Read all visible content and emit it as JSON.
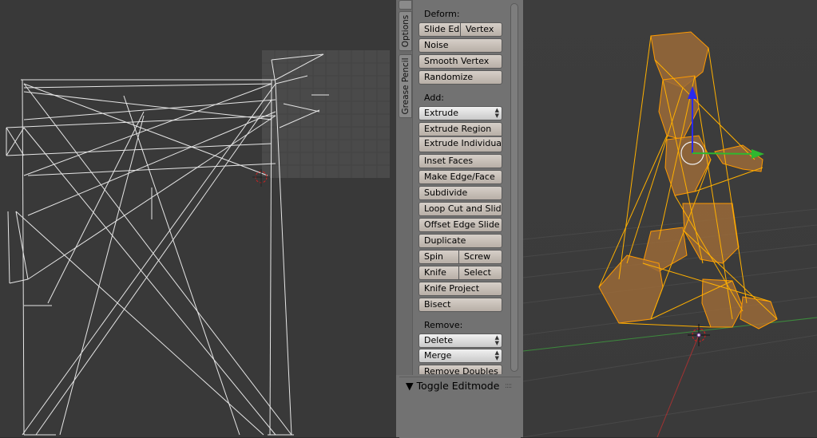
{
  "tabs": {
    "options": "Options",
    "grease_pencil": "Grease Pencil"
  },
  "deform": {
    "label": "Deform:",
    "slide_edge": "Slide Ed",
    "vertex": "Vertex",
    "noise": "Noise",
    "smooth_vertex": "Smooth Vertex",
    "randomize": "Randomize"
  },
  "add": {
    "label": "Add:",
    "extrude": "Extrude",
    "extrude_region": "Extrude Region",
    "extrude_individual": "Extrude Individual",
    "inset_faces": "Inset Faces",
    "make_edge_face": "Make Edge/Face",
    "subdivide": "Subdivide",
    "loop_cut": "Loop Cut and Slide",
    "offset_edge_slide": "Offset Edge Slide",
    "duplicate": "Duplicate",
    "spin": "Spin",
    "screw": "Screw",
    "knife": "Knife",
    "select": "Select",
    "knife_project": "Knife Project",
    "bisect": "Bisect"
  },
  "remove": {
    "label": "Remove:",
    "delete": "Delete",
    "merge": "Merge",
    "remove_doubles": "Remove Doubles"
  },
  "toggle_panel": {
    "arrow": "▼",
    "label": "Toggle Editmode",
    "grip": "::::"
  },
  "colors": {
    "uv_background": "#393939",
    "uv_grid": "#4b4b4b",
    "panel": "#727272",
    "button": "#c8c0b8",
    "viewport": "#3c3c3c",
    "mesh_select": "#ff9a00",
    "mesh_face": "#b07a3a",
    "x_axis": "#b03030",
    "y_axis": "#3a8a3a"
  }
}
